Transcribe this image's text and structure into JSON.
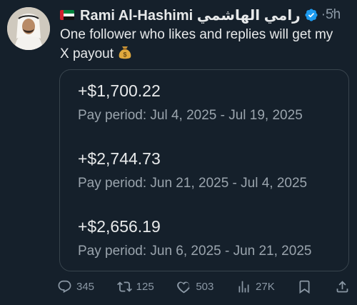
{
  "author": {
    "name": "Rami Al-Hashimi",
    "name_arabic": "رامي الهاشمي",
    "time": "5h",
    "more": "···"
  },
  "tweet_text": {
    "line1": "One follower who likes and replies will get my",
    "line2": "X payout"
  },
  "payouts": [
    {
      "amount": "+$1,700.22",
      "period": "Pay period: Jul 4, 2025 - Jul 19, 2025"
    },
    {
      "amount": "+$2,744.73",
      "period": "Pay period: Jun 21, 2025 - Jul 4, 2025"
    },
    {
      "amount": "+$2,656.19",
      "period": "Pay period: Jun 6, 2025 - Jun 21, 2025"
    }
  ],
  "actions": {
    "replies": "345",
    "reposts": "125",
    "likes": "503",
    "views": "27K"
  },
  "colors": {
    "background": "#15202b",
    "verified": "#1d9bf0",
    "muted": "#8b98a5",
    "border": "#38444d"
  },
  "icons": [
    "uae-flag-icon",
    "verified-badge-icon",
    "more-icon",
    "money-bag-icon",
    "reply-icon",
    "repost-icon",
    "like-icon",
    "views-icon",
    "bookmark-icon",
    "share-icon"
  ]
}
